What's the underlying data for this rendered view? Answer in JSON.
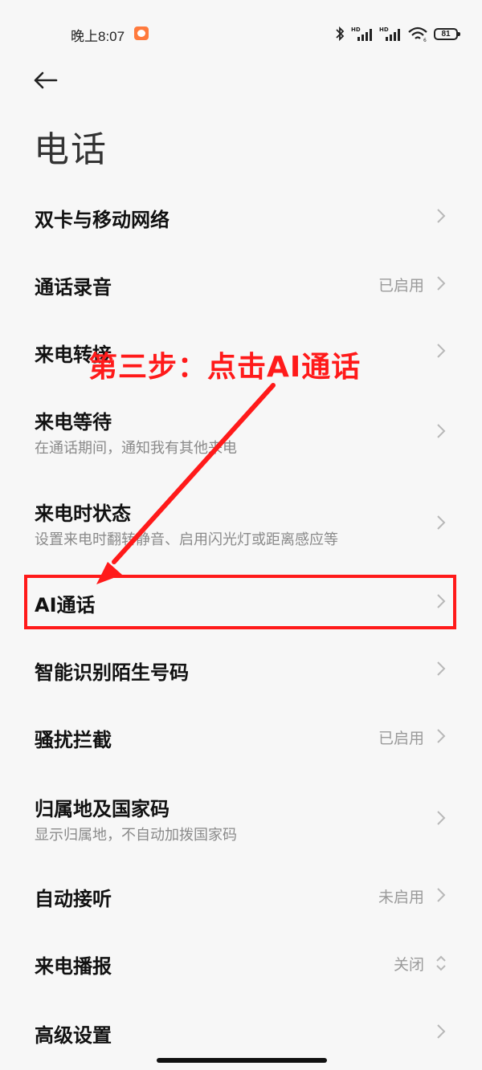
{
  "status_bar": {
    "time": "晚上8:07",
    "battery_level": "81",
    "icons": [
      "notification-badge-icon",
      "bluetooth-icon",
      "hd-signal-icon",
      "hd-signal-icon",
      "wifi-icon",
      "battery-icon"
    ]
  },
  "header": {
    "back_icon": "back-arrow-icon",
    "title": "电话"
  },
  "items": [
    {
      "title": "双卡与移动网络",
      "subtitle": "",
      "value": ""
    },
    {
      "title": "通话录音",
      "subtitle": "",
      "value": "已启用"
    },
    {
      "title": "来电转接",
      "subtitle": "",
      "value": ""
    },
    {
      "title": "来电等待",
      "subtitle": "在通话期间，通知我有其他来电",
      "value": ""
    },
    {
      "title": "来电时状态",
      "subtitle": "设置来电时翻转静音、启用闪光灯或距离感应等",
      "value": ""
    },
    {
      "title": "AI通话",
      "subtitle": "",
      "value": ""
    },
    {
      "title": "智能识别陌生号码",
      "subtitle": "",
      "value": ""
    },
    {
      "title": "骚扰拦截",
      "subtitle": "",
      "value": "已启用"
    },
    {
      "title": "归属地及国家码",
      "subtitle": "显示归属地，不自动加拨国家码",
      "value": ""
    },
    {
      "title": "自动接听",
      "subtitle": "",
      "value": "未启用"
    },
    {
      "title": "来电播报",
      "subtitle": "",
      "value": "关闭"
    },
    {
      "title": "高级设置",
      "subtitle": "",
      "value": ""
    }
  ],
  "annotation": {
    "text": "第三步：点击AI通话",
    "color": "#ff1a1a"
  }
}
